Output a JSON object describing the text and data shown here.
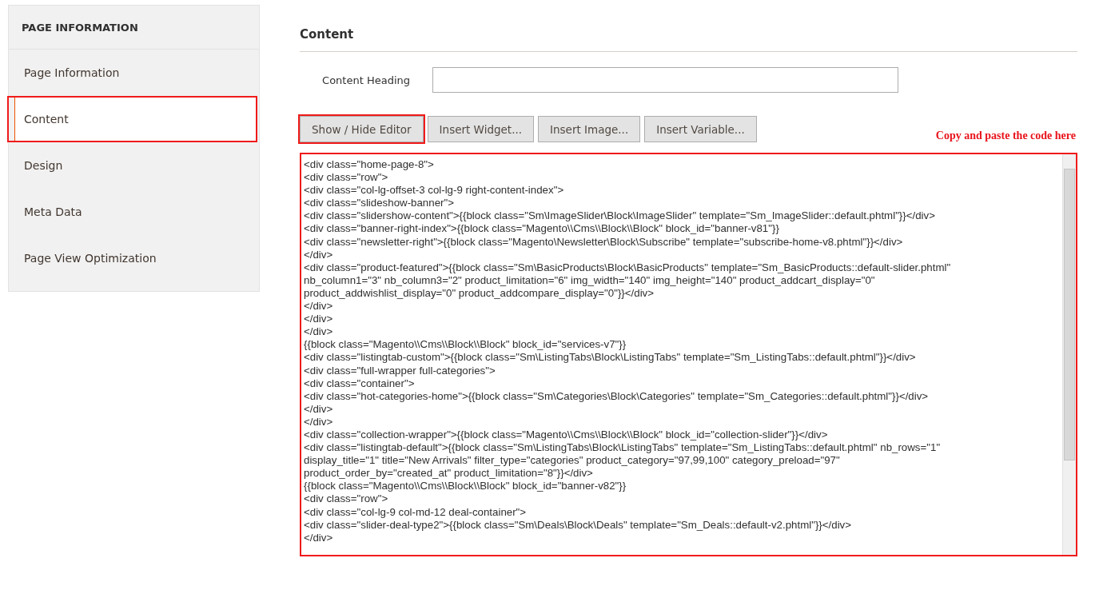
{
  "sidebar": {
    "title": "PAGE INFORMATION",
    "items": [
      {
        "label": "Page Information",
        "selected": false,
        "highlighted": false
      },
      {
        "label": "Content",
        "selected": true,
        "highlighted": true
      },
      {
        "label": "Design",
        "selected": false,
        "highlighted": false
      },
      {
        "label": "Meta Data",
        "selected": false,
        "highlighted": false
      },
      {
        "label": "Page View Optimization",
        "selected": false,
        "highlighted": false
      }
    ]
  },
  "section": {
    "title": "Content",
    "content_heading": {
      "label": "Content Heading"
    },
    "buttons": [
      {
        "label": "Show / Hide Editor",
        "highlighted": true
      },
      {
        "label": "Insert Widget...",
        "highlighted": false
      },
      {
        "label": "Insert Image...",
        "highlighted": false
      },
      {
        "label": "Insert Variable...",
        "highlighted": false
      }
    ],
    "annotation": "Copy and paste the code here",
    "editor": {
      "highlighted": true,
      "lines": [
        "<div class=\"home-page-8\">",
        "<div class=\"row\">",
        "<div class=\"col-lg-offset-3 col-lg-9 right-content-index\">",
        "<div class=\"slideshow-banner\">",
        "<div class=\"slidershow-content\">{{block class=\"Sm\\ImageSlider\\Block\\ImageSlider\" template=\"Sm_ImageSlider::default.phtml\"}}</div>",
        "<div class=\"banner-right-index\">{{block class=\"Magento\\\\Cms\\\\Block\\\\Block\" block_id=\"banner-v81\"}}",
        "<div class=\"newsletter-right\">{{block class=\"Magento\\Newsletter\\Block\\Subscribe\" template=\"subscribe-home-v8.phtml\"}}</div>",
        "</div>",
        "<div class=\"product-featured\">{{block class=\"Sm\\BasicProducts\\Block\\BasicProducts\" template=\"Sm_BasicProducts::default-slider.phtml\"",
        "nb_column1=\"3\" nb_column3=\"2\" product_limitation=\"6\" img_width=\"140\" img_height=\"140\" product_addcart_display=\"0\"",
        "product_addwishlist_display=\"0\" product_addcompare_display=\"0\"}}</div>",
        "</div>",
        "</div>",
        "</div>",
        "{{block class=\"Magento\\\\Cms\\\\Block\\\\Block\" block_id=\"services-v7\"}}",
        "<div class=\"listingtab-custom\">{{block class=\"Sm\\ListingTabs\\Block\\ListingTabs\" template=\"Sm_ListingTabs::default.phtml\"}}</div>",
        "<div class=\"full-wrapper full-categories\">",
        "<div class=\"container\">",
        "<div class=\"hot-categories-home\">{{block class=\"Sm\\Categories\\Block\\Categories\" template=\"Sm_Categories::default.phtml\"}}</div>",
        "</div>",
        "</div>",
        "<div class=\"collection-wrapper\">{{block class=\"Magento\\\\Cms\\\\Block\\\\Block\" block_id=\"collection-slider\"}}</div>",
        "<div class=\"listingtab-default\">{{block class=\"Sm\\ListingTabs\\Block\\ListingTabs\" template=\"Sm_ListingTabs::default.phtml\" nb_rows=\"1\"",
        "display_title=\"1\" title=\"New Arrivals\" filter_type=\"categories\" product_category=\"97,99,100\" category_preload=\"97\"",
        "product_order_by=\"created_at\" product_limitation=\"8\"}}</div>",
        "{{block class=\"Magento\\\\Cms\\\\Block\\\\Block\" block_id=\"banner-v82\"}}",
        "<div class=\"row\">",
        "<div class=\"col-lg-9 col-md-12 deal-container\">",
        "<div class=\"slider-deal-type2\">{{block class=\"Sm\\Deals\\Block\\Deals\" template=\"Sm_Deals::default-v2.phtml\"}}</div>",
        "</div>"
      ]
    }
  }
}
